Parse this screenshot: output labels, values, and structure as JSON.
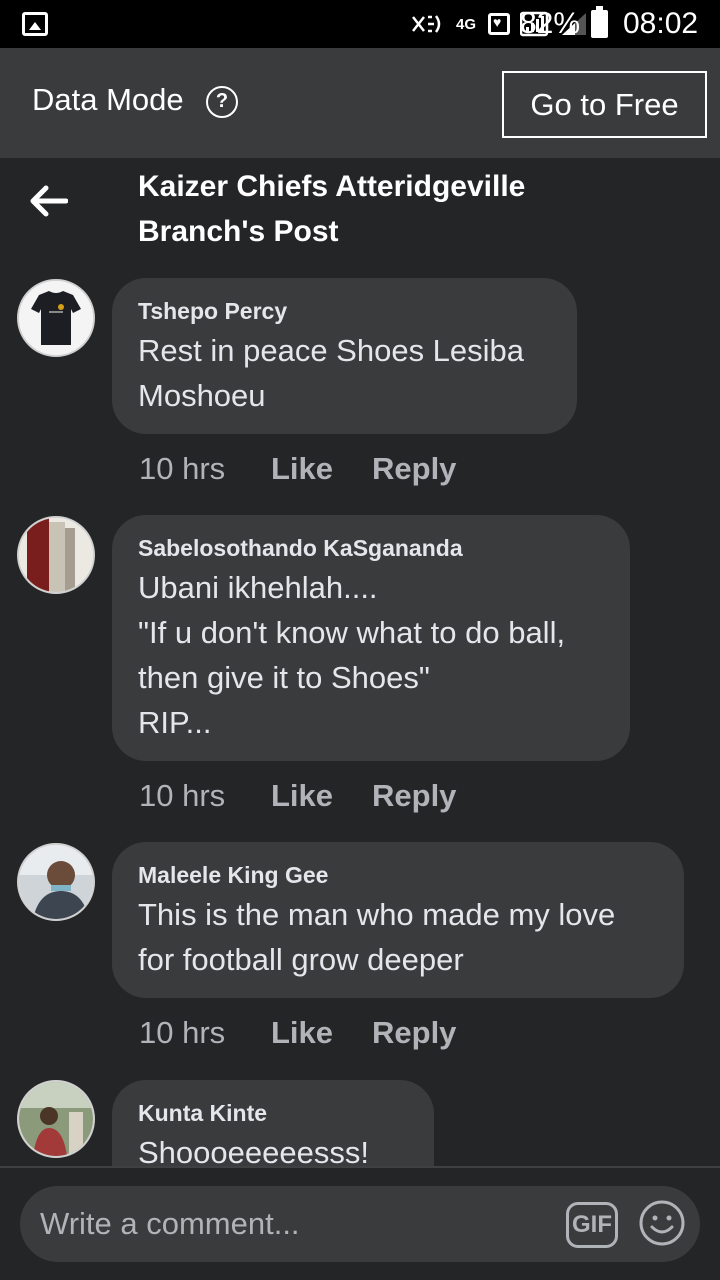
{
  "status_bar": {
    "network": "4G",
    "battery": "82%",
    "time": "08:02",
    "icons": [
      "gallery-icon",
      "nfc-icon",
      "heart-notification-icon",
      "signal-icon",
      "battery-icon"
    ]
  },
  "data_mode": {
    "label": "Data Mode",
    "help_icon": "?",
    "go_free_label": "Go to Free"
  },
  "header": {
    "title": "Kaizer Chiefs Atteridgeville Branch's Post",
    "back_icon": "back-arrow-icon"
  },
  "comments": [
    {
      "author": "Tshepo Percy",
      "text": "Rest in peace Shoes Lesiba\nMoshoeu",
      "time": "10 hrs",
      "like": "Like",
      "reply": "Reply"
    },
    {
      "author": "Sabelosothando KaSgananda",
      "text": "Ubani ikhehlah....\n\"If u don't know what to do ball,\nthen give it to Shoes\"\nRIP...",
      "time": "10 hrs",
      "like": "Like",
      "reply": "Reply"
    },
    {
      "author": "Maleele King Gee",
      "text": "This is the man who made my love\nfor football grow deeper",
      "time": "10 hrs",
      "like": "Like",
      "reply": "Reply"
    },
    {
      "author": "Kunta Kinte",
      "text": "Shoooeeeeesss!"
    }
  ],
  "composer": {
    "placeholder": "Write a comment...",
    "gif_label": "GIF",
    "emoji_icon": "emoji-icon"
  },
  "colors": {
    "background": "#242527",
    "bubble": "#3a3b3c",
    "data_bar": "#3a3b3d",
    "text": "#e4e6eb",
    "muted": "#b0b3b8"
  }
}
